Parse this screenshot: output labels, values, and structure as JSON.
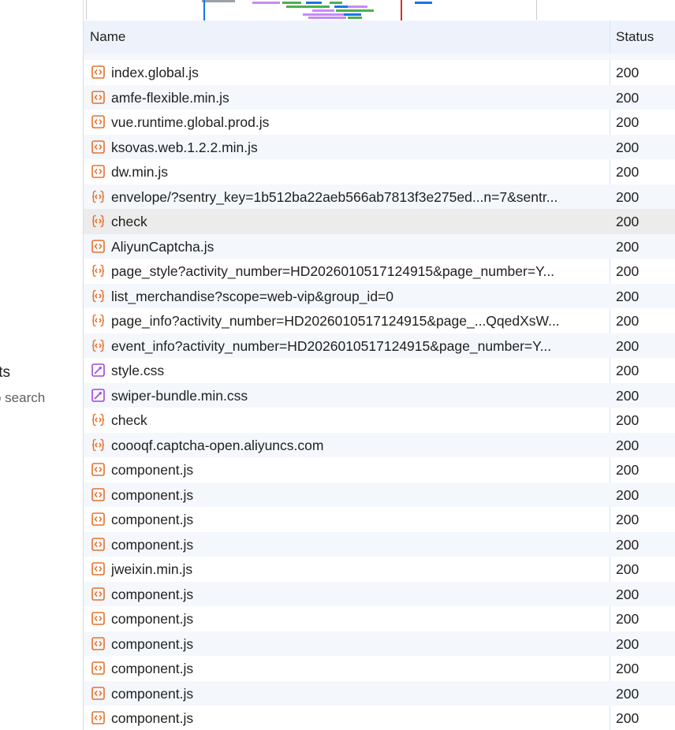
{
  "left_panel": {
    "title": "lts",
    "hint": "o search"
  },
  "table": {
    "columns": {
      "name": "Name",
      "status": "Status"
    },
    "rows": [
      {
        "name": "index.global.js",
        "status": "200",
        "type": "script-icon"
      },
      {
        "name": "amfe-flexible.min.js",
        "status": "200",
        "type": "script-icon"
      },
      {
        "name": "vue.runtime.global.prod.js",
        "status": "200",
        "type": "script-icon"
      },
      {
        "name": "ksovas.web.1.2.2.min.js",
        "status": "200",
        "type": "script-icon"
      },
      {
        "name": "dw.min.js",
        "status": "200",
        "type": "script-icon"
      },
      {
        "name": "envelope/?sentry_key=1b512ba22aeb566ab7813f3e275ed...n=7&sentr...",
        "status": "200",
        "type": "fetch-icon"
      },
      {
        "name": "check",
        "status": "200",
        "type": "fetch-icon"
      },
      {
        "name": "AliyunCaptcha.js",
        "status": "200",
        "type": "script-icon"
      },
      {
        "name": "page_style?activity_number=HD2026010517124915&page_number=Y...",
        "status": "200",
        "type": "fetch-icon"
      },
      {
        "name": "list_merchandise?scope=web-vip&group_id=0",
        "status": "200",
        "type": "fetch-icon"
      },
      {
        "name": "page_info?activity_number=HD2026010517124915&page_...QqedXsW...",
        "status": "200",
        "type": "fetch-icon"
      },
      {
        "name": "event_info?activity_number=HD2026010517124915&page_number=Y...",
        "status": "200",
        "type": "fetch-icon"
      },
      {
        "name": "style.css",
        "status": "200",
        "type": "stylesheet-icon"
      },
      {
        "name": "swiper-bundle.min.css",
        "status": "200",
        "type": "stylesheet-icon"
      },
      {
        "name": "check",
        "status": "200",
        "type": "fetch-icon"
      },
      {
        "name": "coooqf.captcha-open.aliyuncs.com",
        "status": "200",
        "type": "fetch-icon"
      },
      {
        "name": "component.js",
        "status": "200",
        "type": "script-icon"
      },
      {
        "name": "component.js",
        "status": "200",
        "type": "script-icon"
      },
      {
        "name": "component.js",
        "status": "200",
        "type": "script-icon"
      },
      {
        "name": "component.js",
        "status": "200",
        "type": "script-icon"
      },
      {
        "name": "jweixin.min.js",
        "status": "200",
        "type": "script-icon"
      },
      {
        "name": "component.js",
        "status": "200",
        "type": "script-icon"
      },
      {
        "name": "component.js",
        "status": "200",
        "type": "script-icon"
      },
      {
        "name": "component.js",
        "status": "200",
        "type": "script-icon"
      },
      {
        "name": "component.js",
        "status": "200",
        "type": "script-icon"
      },
      {
        "name": "component.js",
        "status": "200",
        "type": "script-icon"
      },
      {
        "name": "component.js",
        "status": "200",
        "type": "script-icon"
      }
    ],
    "selected_index": 6
  },
  "colors": {
    "script": "#e8702a",
    "fetch": "#e8702a",
    "stylesheet": "#a046d8",
    "header_bg": "#eef3fb",
    "alt_row": "#f4f7fc",
    "selected_row": "#ececec"
  }
}
